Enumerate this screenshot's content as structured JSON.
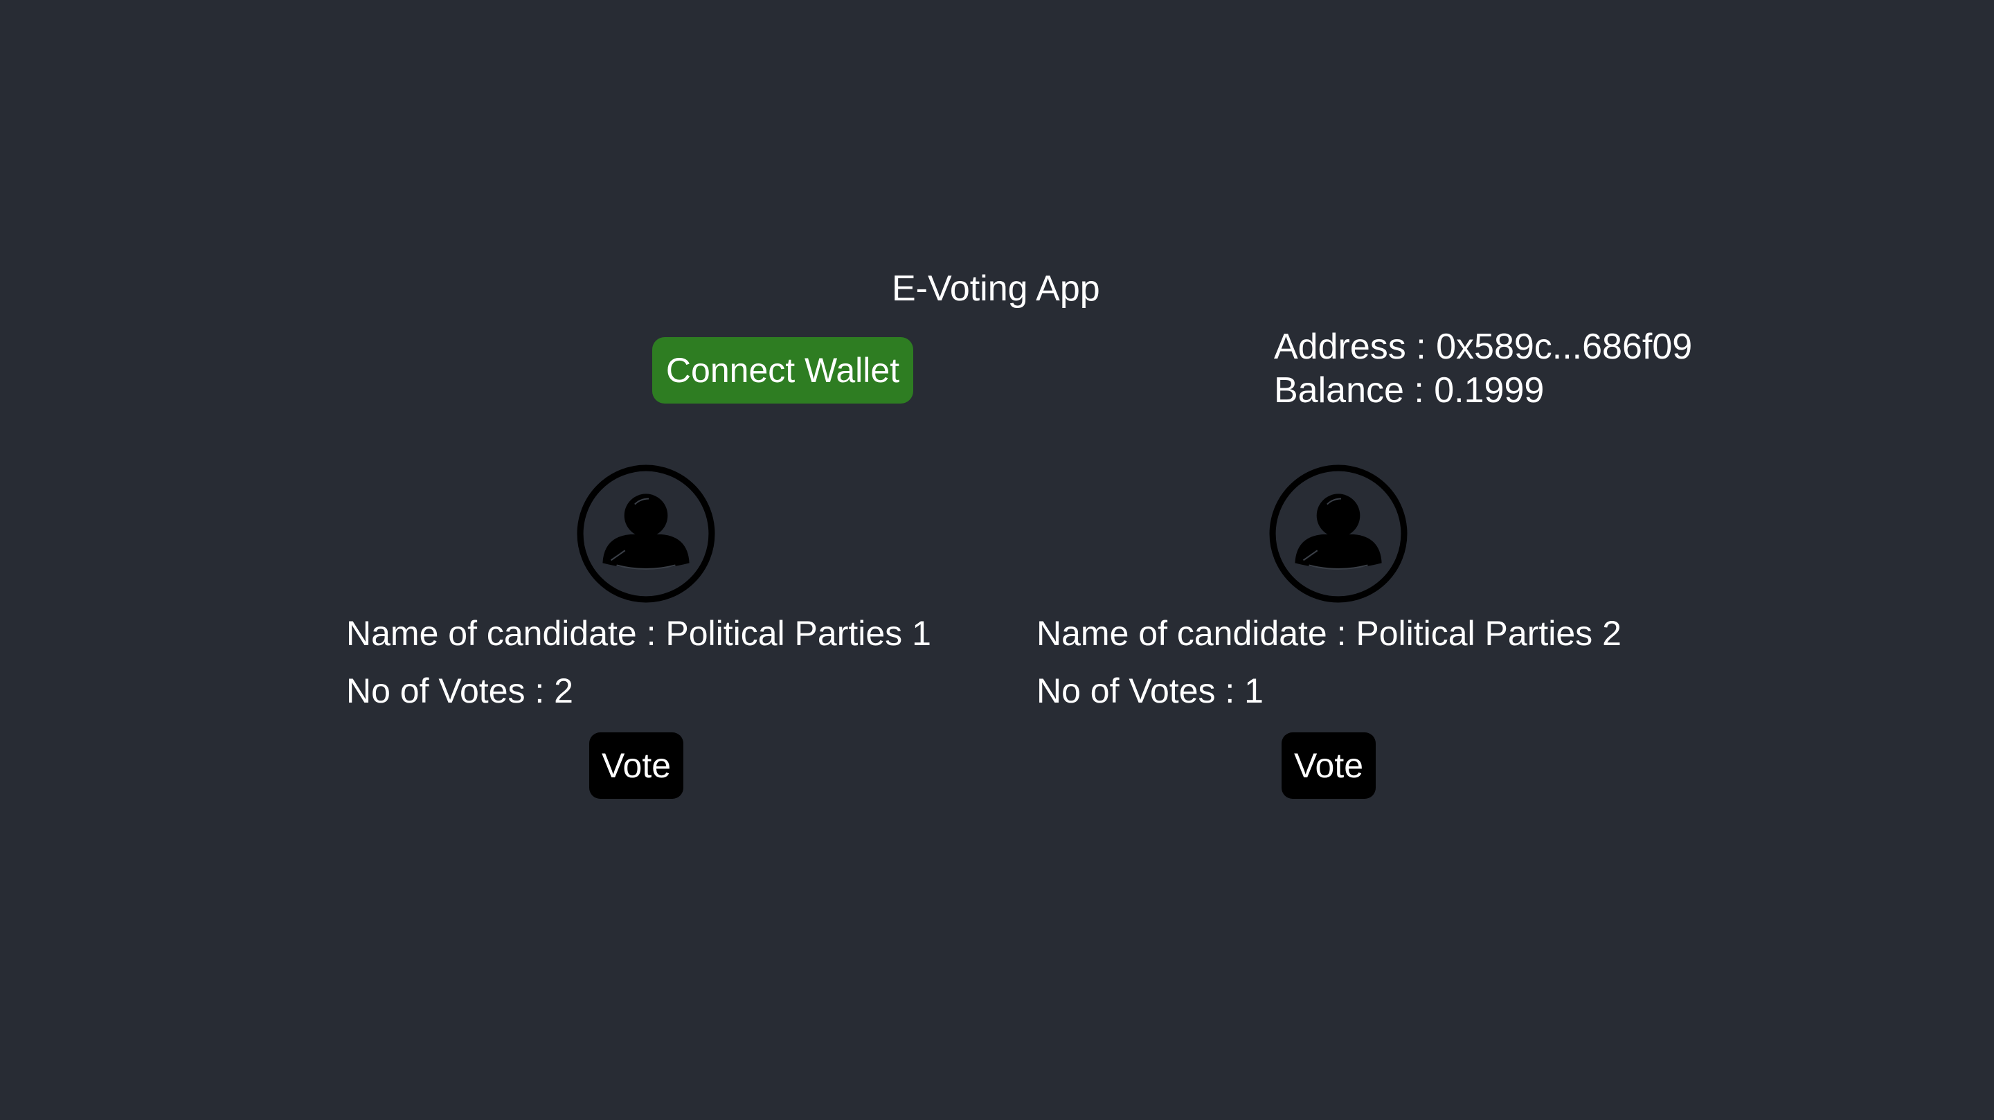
{
  "app": {
    "title": "E-Voting App"
  },
  "wallet": {
    "connect_label": "Connect Wallet",
    "address_text": "Address : 0x589c...686f09",
    "balance_text": "Balance : 0.1999"
  },
  "candidates": [
    {
      "avatar_icon": "user-avatar-icon",
      "name_text": "Name of candidate : Political Parties 1",
      "votes_text": "No of Votes : 2",
      "vote_label": "Vote"
    },
    {
      "avatar_icon": "user-avatar-icon",
      "name_text": "Name of candidate : Political Parties 2",
      "votes_text": "No of Votes : 1",
      "vote_label": "Vote"
    }
  ],
  "colors": {
    "background": "#282c34",
    "connect_button": "#2e7d22",
    "vote_button": "#000000",
    "text": "#ffffff"
  }
}
